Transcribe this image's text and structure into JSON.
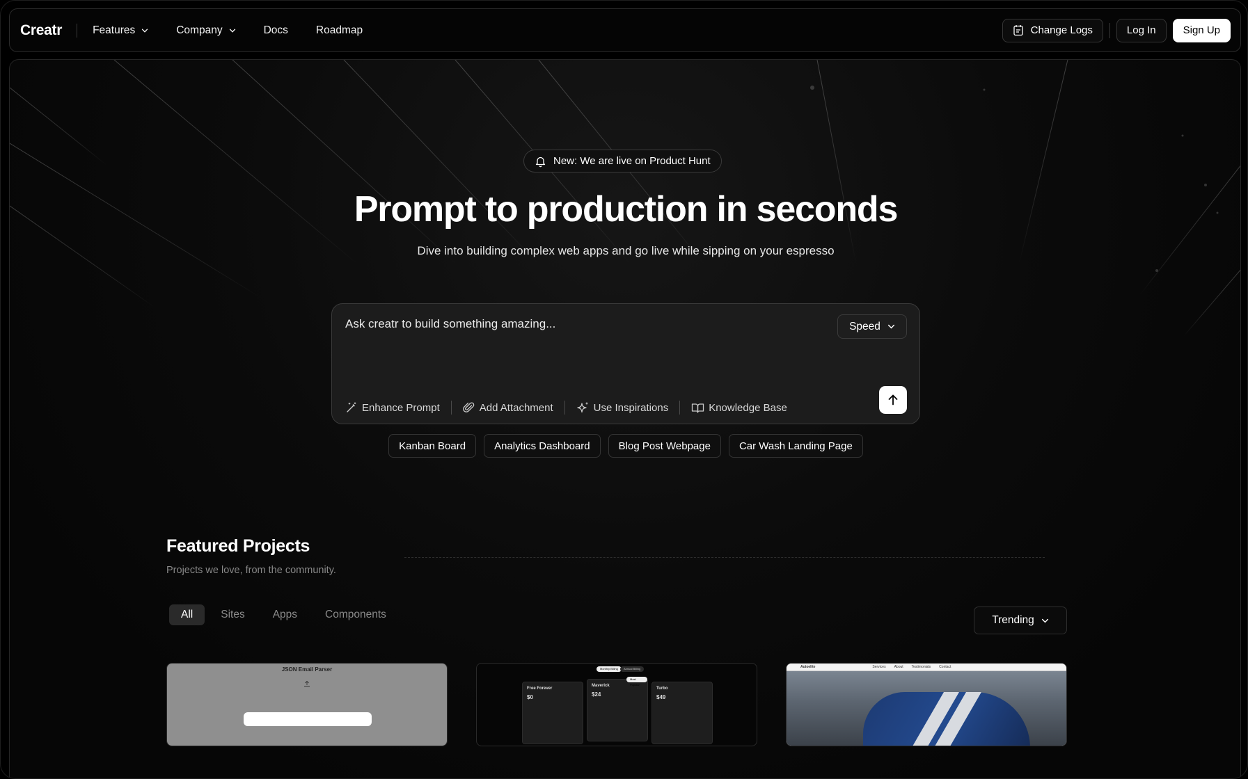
{
  "nav": {
    "logo": "Creatr",
    "links": [
      {
        "label": "Features",
        "has_dropdown": true
      },
      {
        "label": "Company",
        "has_dropdown": true
      },
      {
        "label": "Docs",
        "has_dropdown": false
      },
      {
        "label": "Roadmap",
        "has_dropdown": false
      }
    ],
    "change_logs_label": "Change Logs",
    "login_label": "Log In",
    "signup_label": "Sign Up"
  },
  "hero": {
    "badge": "New: We are live on Product Hunt",
    "title": "Prompt to production in seconds",
    "subtitle": "Dive into building complex web apps and go live while sipping on your espresso"
  },
  "prompt": {
    "placeholder": "Ask creatr to build something amazing...",
    "mode": "Speed",
    "tools": [
      "Enhance Prompt",
      "Add Attachment",
      "Use Inspirations",
      "Knowledge Base"
    ],
    "suggestions": [
      "Kanban Board",
      "Analytics Dashboard",
      "Blog Post Webpage",
      "Car Wash Landing Page"
    ]
  },
  "featured": {
    "title": "Featured Projects",
    "subtitle": "Projects we love, from the community.",
    "tabs": [
      "All",
      "Sites",
      "Apps",
      "Components"
    ],
    "active_tab": "All",
    "sort": "Trending",
    "cards": [
      {
        "title": "JSON Email Parser"
      },
      {
        "plans": [
          {
            "name": "Free Forever",
            "price": "$0"
          },
          {
            "name": "Maverick",
            "price": "$24"
          },
          {
            "name": "Turbo",
            "price": "$49"
          }
        ],
        "toggle": [
          "Monthly Billing",
          "Annual Billing"
        ],
        "flag": "Most Popular"
      },
      {
        "brand": "Autoelite",
        "menu": [
          "Services",
          "About",
          "Testimonials",
          "Contact"
        ]
      }
    ]
  },
  "colors": {
    "background": "#000000",
    "panel": "#1c1c1c",
    "accent": "#ffffff"
  }
}
